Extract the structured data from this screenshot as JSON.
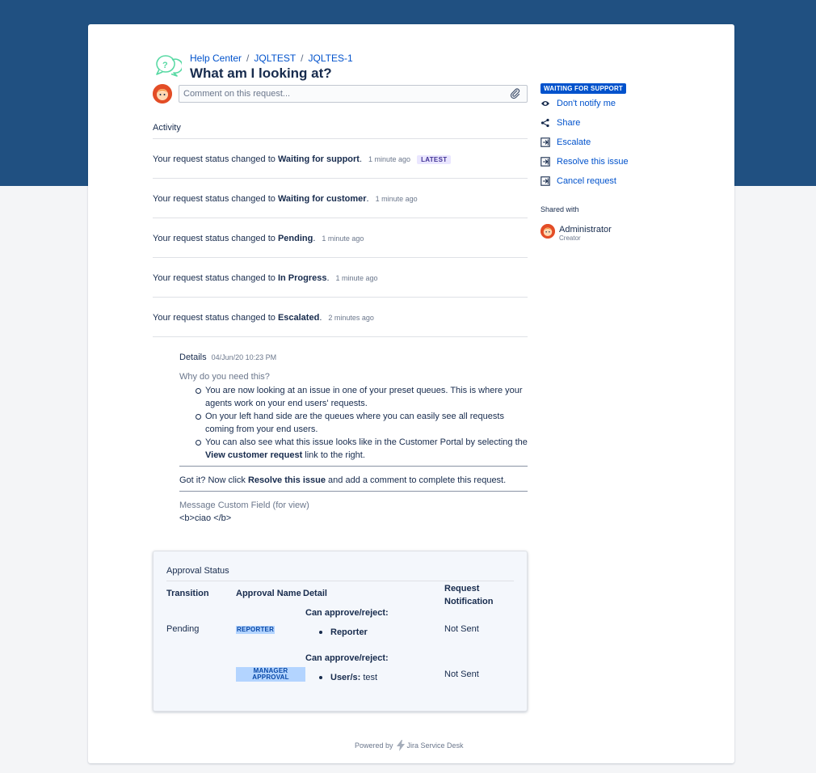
{
  "breadcrumb": {
    "help_center": "Help Center",
    "project": "JQLTEST",
    "issue": "JQLTES-1",
    "separator": "/"
  },
  "request": {
    "title": "What am I looking at?"
  },
  "comment": {
    "placeholder": "Comment on this request..."
  },
  "activity": {
    "title": "Activity",
    "prefix": "Your request status changed to",
    "items": [
      {
        "status": "Waiting for support",
        "time": "1 minute ago",
        "badge": "LATEST"
      },
      {
        "status": "Waiting for customer",
        "time": "1 minute ago"
      },
      {
        "status": "Pending",
        "time": "1 minute ago"
      },
      {
        "status": "In Progress",
        "time": "1 minute ago"
      },
      {
        "status": "Escalated",
        "time": "2 minutes ago"
      }
    ]
  },
  "details": {
    "label": "Details",
    "date": "04/Jun/20 10:23 PM",
    "question": "Why do you need this?",
    "bullets": [
      "You are now looking at an issue in one of your preset queues. This is where your agents work on your end users' requests.",
      "On your left hand side are the queues where you can easily see all requests coming from your end users.",
      "You can also see what this issue looks like in the Customer Portal by selecting the",
      "View customer request",
      "link to the right."
    ],
    "gotit_pre": "Got it? Now click",
    "gotit_bold": "Resolve this issue",
    "gotit_post": "and add a comment to complete this request.",
    "custom_field_label": "Message Custom Field (for view)",
    "custom_field_value": "<b>ciao </b>"
  },
  "approval": {
    "heading": "Approval Status",
    "columns": {
      "transition": "Transition",
      "approval_name": "Approval Name",
      "detail": "Detail",
      "request_notification": "Request Notification"
    },
    "rows": [
      {
        "transition": "Pending",
        "name": "REPORTER",
        "detail_title": "Can approve/reject:",
        "detail_label": "Reporter",
        "detail_value": "",
        "notification": "Not Sent"
      },
      {
        "transition": "",
        "name": "MANAGER APPROVAL",
        "detail_title": "Can approve/reject:",
        "detail_label": "User/s:",
        "detail_value": "test",
        "notification": "Not Sent"
      }
    ]
  },
  "sidebar": {
    "status": "WAITING FOR SUPPORT",
    "actions": [
      {
        "label": "Don't notify me",
        "icon": "eye-icon"
      },
      {
        "label": "Share",
        "icon": "share-icon"
      },
      {
        "label": "Escalate",
        "icon": "transition-icon"
      },
      {
        "label": "Resolve this issue",
        "icon": "transition-icon"
      },
      {
        "label": "Cancel request",
        "icon": "transition-icon"
      }
    ],
    "shared_with_title": "Shared with",
    "shared_user": {
      "name": "Administrator",
      "role": "Creator"
    }
  },
  "footer": {
    "powered_by": "Powered by",
    "product": "Jira Service Desk"
  },
  "colors": {
    "header_band": "#205081",
    "link": "#0052cc",
    "status_lozenge": "#0052cc",
    "latest_badge_bg": "#eae6ff"
  }
}
